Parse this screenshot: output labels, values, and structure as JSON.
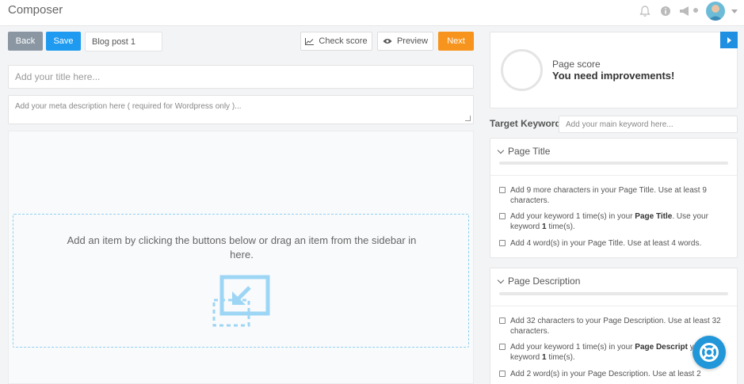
{
  "header": {
    "title": "Composer"
  },
  "toolbar": {
    "back_label": "Back",
    "save_label": "Save",
    "post_name": "Blog post 1",
    "check_score_label": "Check score",
    "preview_label": "Preview",
    "next_label": "Next"
  },
  "editor": {
    "title_placeholder": "Add your title here...",
    "meta_placeholder": "Add your meta description here ( required for Wordpress only )...",
    "dropzone_text": "Add an item by clicking the buttons below or drag an item from the sidebar in here."
  },
  "score": {
    "label": "Page score",
    "status": "You need improvements!"
  },
  "keyword": {
    "label": "Target Keyword",
    "placeholder": "Add your main keyword here..."
  },
  "sections": {
    "page_title": {
      "title": "Page Title",
      "items": [
        {
          "text": "Add 9 more characters in your Page Title. Use at least 9 characters."
        },
        {
          "pre": "Add your keyword 1 time(s) in your ",
          "bold": "Page Title",
          "mid": ". Use your keyword ",
          "bold2": "1",
          "post": " time(s)."
        },
        {
          "text": "Add 4 word(s) in your Page Title. Use at least 4 words."
        }
      ]
    },
    "page_description": {
      "title": "Page Description",
      "items": [
        {
          "text": "Add 32 characters to your Page Description. Use at least 32 characters."
        },
        {
          "pre": "Add your keyword 1 time(s) in your ",
          "bold": "Page Descript",
          "mid": " your keyword ",
          "bold2": "1",
          "post": " time(s)."
        },
        {
          "text": "Add 2 word(s) in your Page Description. Use at least 2"
        }
      ]
    }
  },
  "colors": {
    "primary": "#1e9bf0",
    "next": "#f7941d",
    "back": "#8a97a3",
    "dropzone": "#8fd1f0"
  }
}
